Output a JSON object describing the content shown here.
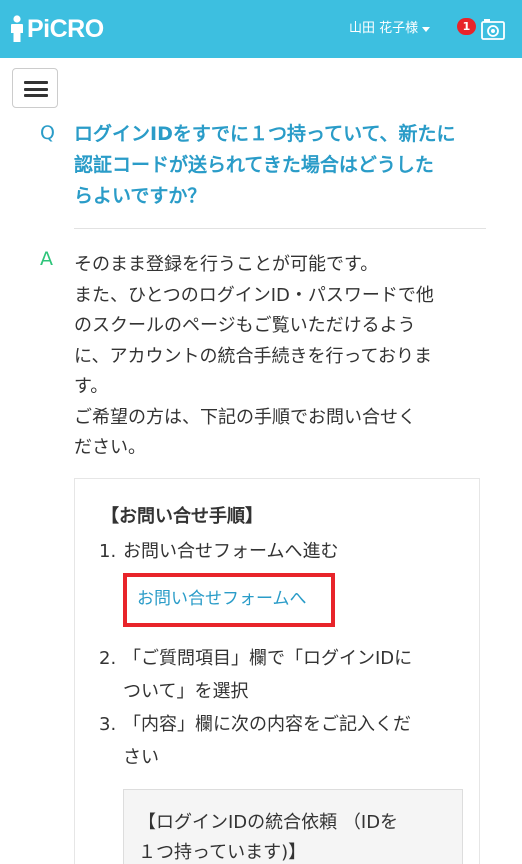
{
  "header": {
    "brand": "PiCRO",
    "user_name": "山田 花子様",
    "notification_count": "1",
    "background_color": "#3dbfe0",
    "icons": [
      "person-icon",
      "caret-down-icon",
      "camera-icon"
    ]
  },
  "nav": {
    "menu_icon": "hamburger-icon"
  },
  "faq": {
    "q_marker": "Q",
    "question_lines": [
      "ログインIDをすでに１つ持っていて、新たに",
      "認証コードが送られてきた場合はどうした",
      "らよいですか？"
    ],
    "a_marker": "A",
    "answer_lines": [
      "そのまま登録を行うことが可能です。",
      "また、ひとつのログインID・パスワードで他",
      "のスクールのページもご覧いただけるよう",
      "に、アカウントの統合手続きを行っておりま",
      "す。",
      "ご希望の方は、下記の手順でお問い合せく",
      "ださい。"
    ],
    "steps_title": "【お問い合せ手順】",
    "steps": [
      {
        "num": "1.",
        "lines": [
          "お問い合せフォームへ進む"
        ]
      },
      {
        "num": "2.",
        "lines": [
          "「ご質問項目」欄で「ログインIDに",
          "ついて」を選択"
        ]
      },
      {
        "num": "3.",
        "lines": [
          "「内容」欄に次の内容をご記入くだ",
          "さい"
        ]
      }
    ],
    "contact_link": "お問い合せフォームへ",
    "request_lines": [
      "【ログインIDの統合依頼 （IDを",
      "１つ持っています)】"
    ],
    "colors": {
      "question": "#2a9cc8",
      "answer_marker": "#2ec47a",
      "highlight": "#e8242a"
    }
  }
}
